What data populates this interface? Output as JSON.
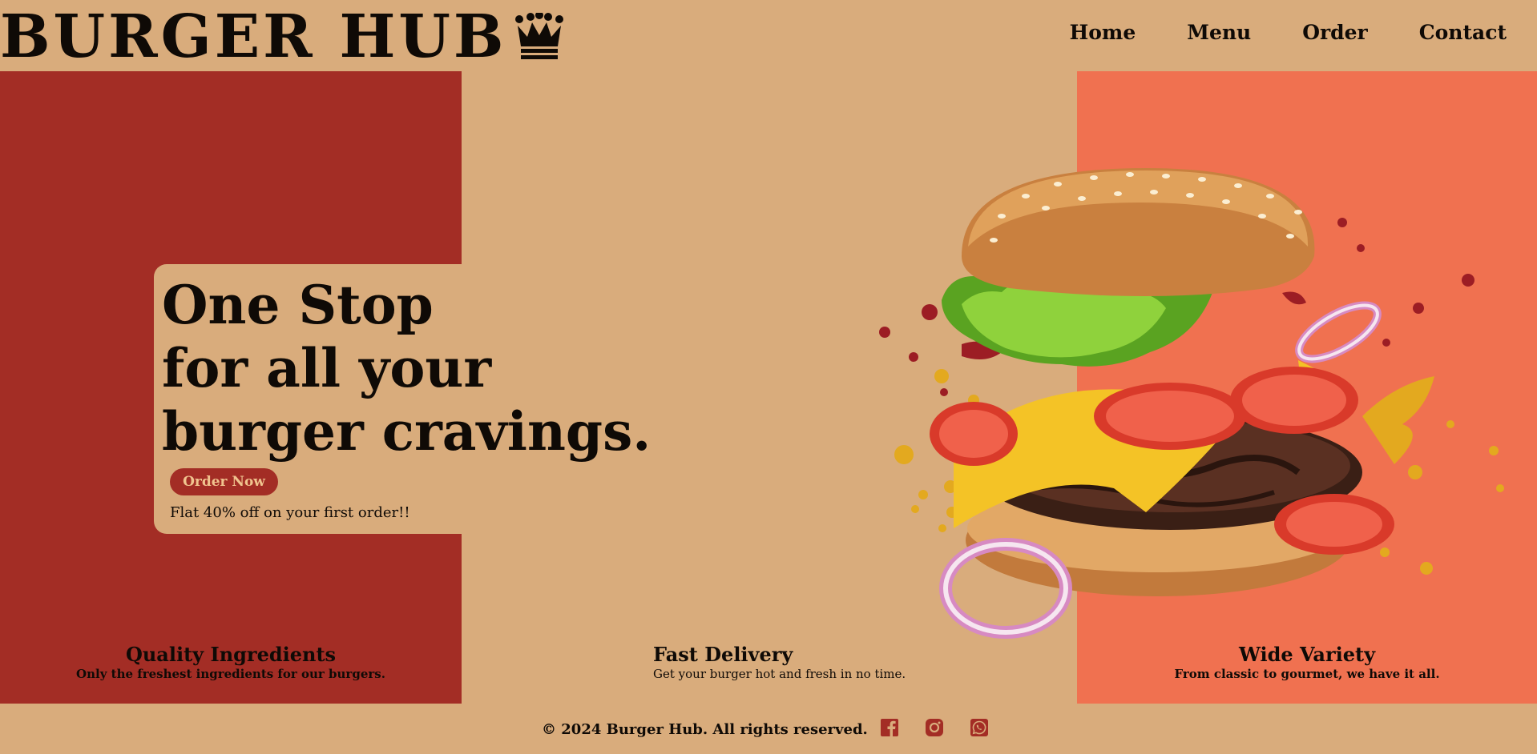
{
  "brand": {
    "name": "BURGER HUB",
    "logo_icon": "crown-icon"
  },
  "nav": {
    "items": [
      "Home",
      "Menu",
      "Order",
      "Contact"
    ]
  },
  "hero": {
    "title_lines": [
      "One Stop",
      "for all your",
      "burger cravings."
    ],
    "cta_label": "Order Now",
    "offer": "Flat 40% off on your first order!!"
  },
  "features": [
    {
      "title": "Quality Ingredients",
      "text": "Only the freshest ingredients for our burgers."
    },
    {
      "title": "Fast Delivery",
      "text": "Get your burger hot and fresh in no time."
    },
    {
      "title": "Wide Variety",
      "text": "From classic to gourmet, we have it all."
    }
  ],
  "footer": {
    "copyright": "© 2024 Burger Hub. All rights reserved.",
    "social_icons": [
      "facebook-icon",
      "instagram-icon",
      "whatsapp-icon"
    ]
  },
  "colors": {
    "background": "#d9ac7c",
    "left_panel": "#a32d25",
    "right_panel": "#f07150",
    "button": "#a32d25",
    "button_text": "#f0c48f",
    "text": "#0f0a06",
    "social_icon": "#a32d25"
  }
}
